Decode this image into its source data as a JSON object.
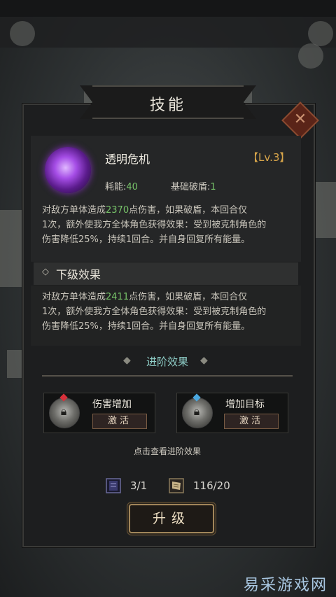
{
  "background": {
    "status_time": "",
    "battery": "",
    "resource_a": "",
    "resource_b": "",
    "resource_c": "",
    "bottom_text": ""
  },
  "watermark": "易采游戏网",
  "dialog": {
    "title": "技能",
    "close_icon": "close-x-icon",
    "skill": {
      "name": "透明危机",
      "level": "【Lv.3】",
      "cost_label": "耗能:",
      "cost_value": "40",
      "break_label": "基础破盾:",
      "break_value": "1",
      "desc": {
        "p1": "对敌方单体造成",
        "num": "2370",
        "p2": "点伤害，如果破盾，本回合仅",
        "l2": "1次，额外使我方全体角色获得效果：受到被克制角色的",
        "l3": "伤害降低25%，持续1回合。并自身回复所有能量。"
      }
    },
    "next_level": {
      "glyph": "◇",
      "header": "下级效果",
      "desc": {
        "p1": "对敌方单体造成",
        "num": "2411",
        "p2": "点伤害，如果破盾，本回合仅",
        "l2": "1次，额外使我方全体角色获得效果：受到被克制角色的",
        "l3": "伤害降低25%，持续1回合。并自身回复所有能量。"
      }
    },
    "advanced": {
      "title": "进阶效果",
      "arrow_left": "◆",
      "arrow_right": "◆",
      "items": [
        {
          "name": "伤害增加",
          "button": "激活",
          "gem_color": "#d8303a",
          "icon": "locked-shield-icon"
        },
        {
          "name": "增加目标",
          "button": "激活",
          "gem_color": "#4aa8e0",
          "icon": "locked-shield-icon"
        }
      ],
      "hint": "点击查看进阶效果"
    },
    "costs": {
      "book_value": "3/1",
      "scroll_value": "116/20"
    },
    "upgrade_label": "升级"
  },
  "colors": {
    "highlight_green": "#78c46a",
    "level_gold": "#d8a54a",
    "advanced_teal": "#8fcfc8"
  }
}
